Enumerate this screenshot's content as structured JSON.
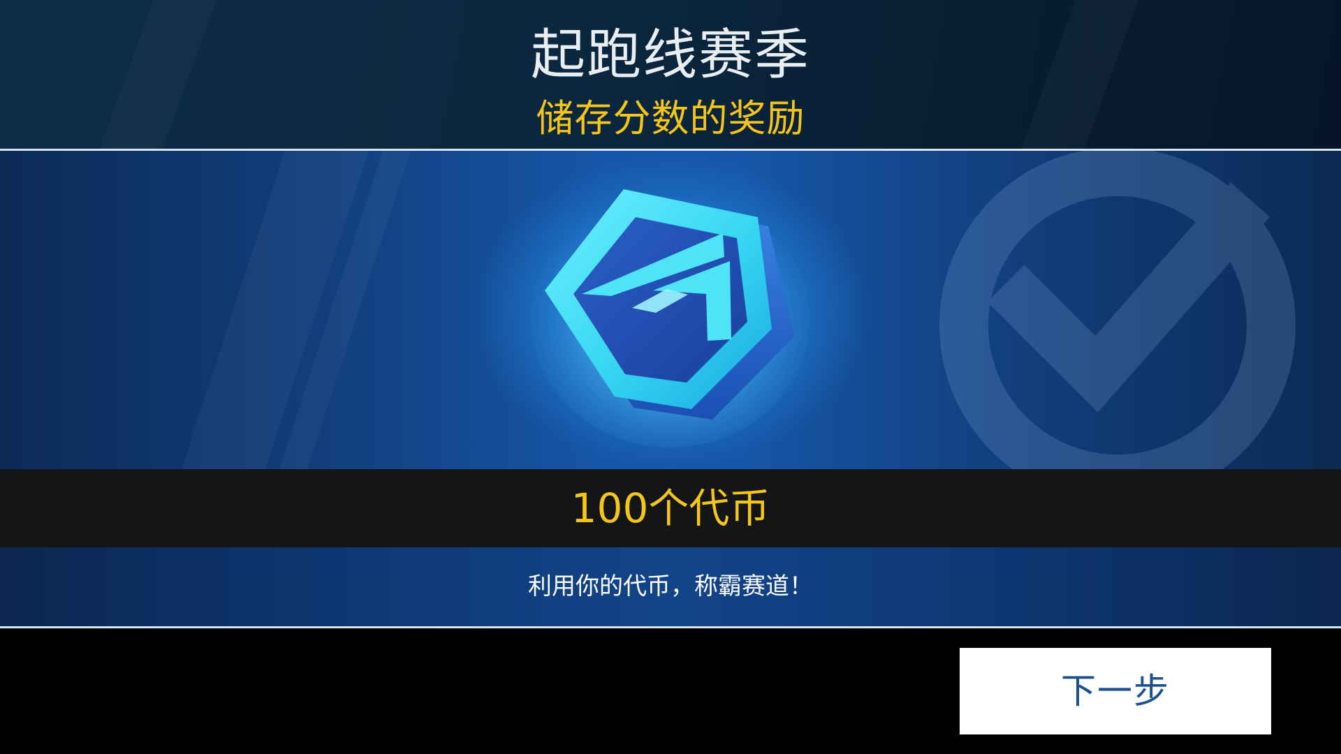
{
  "header": {
    "title": "起跑线赛季",
    "subtitle": "储存分数的奖励"
  },
  "reward": {
    "icon": "token-hexagon-icon",
    "decoration_icon": "checkmark-circle-icon",
    "amount_text": "100个代币",
    "description": "利用你的代币，称霸赛道！"
  },
  "footer": {
    "next_label": "下一步"
  },
  "colors": {
    "accent_gold": "#f5c518",
    "header_bg": "#0b2840",
    "panel_blue": "#1656a8",
    "token_cyan": "#36d6f2",
    "button_text": "#1b4f8f"
  }
}
